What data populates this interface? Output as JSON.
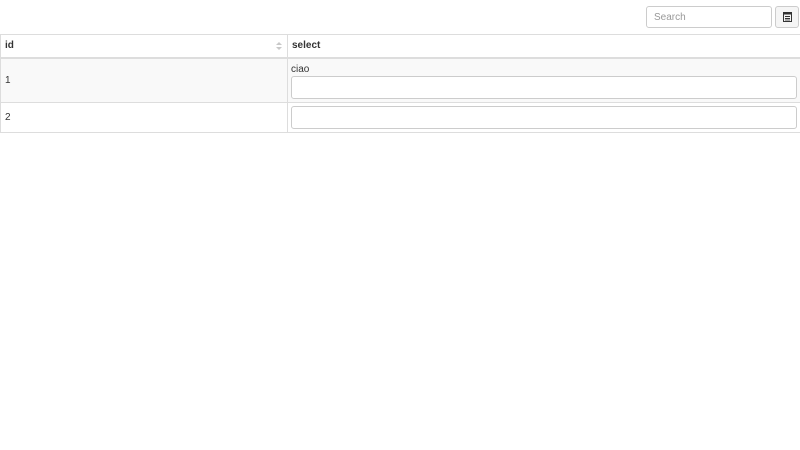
{
  "toolbar": {
    "search_placeholder": "Search",
    "columns_icon": "columns-list-icon"
  },
  "table": {
    "headers": {
      "id": "id",
      "select": "select"
    },
    "sort_icon": "sort-both-icon",
    "rows": [
      {
        "id": "1",
        "select_label": "ciao",
        "select_value": ""
      },
      {
        "id": "2",
        "select_label": "",
        "select_value": ""
      }
    ]
  }
}
